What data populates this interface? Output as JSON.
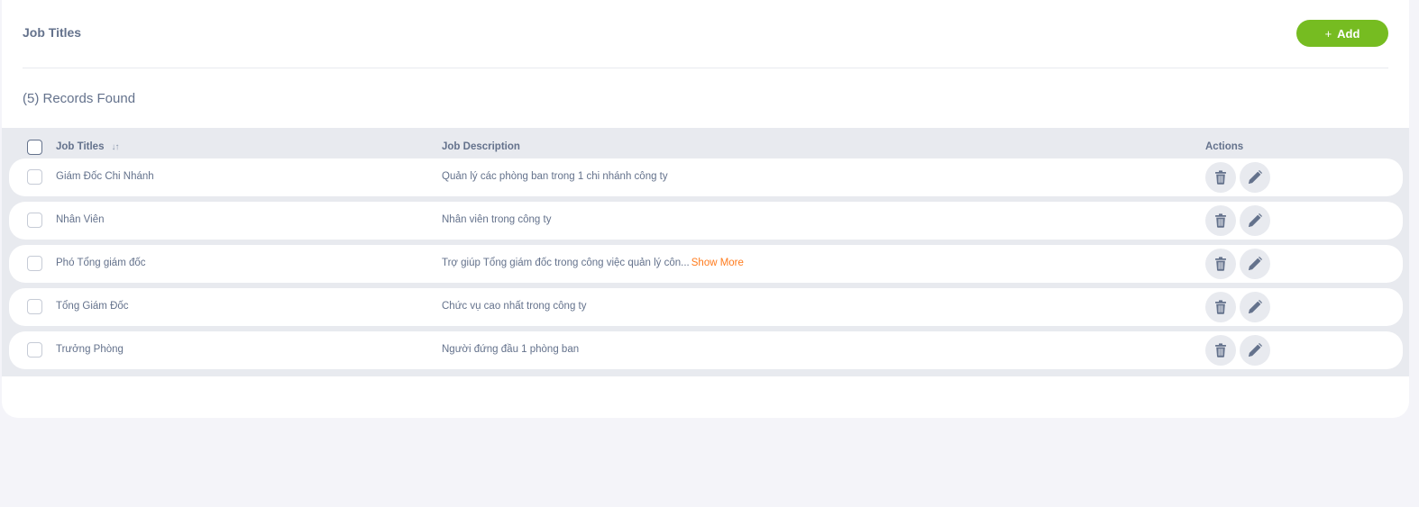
{
  "header": {
    "title": "Job Titles",
    "add_label": "Add",
    "add_icon": "plus-icon",
    "accent_color": "#76bc21"
  },
  "records_found": "(5) Records Found",
  "table": {
    "columns": {
      "title": "Job Titles",
      "description": "Job Description",
      "actions": "Actions"
    },
    "rows": [
      {
        "title": "Giám Đốc Chi Nhánh",
        "description": "Quản lý các phòng ban trong 1 chi nhánh công ty",
        "more": ""
      },
      {
        "title": "Nhân Viên",
        "description": "Nhân viên trong công ty",
        "more": ""
      },
      {
        "title": "Phó Tổng giám đốc",
        "description": "Trợ giúp Tổng giám đốc trong công việc quản lý côn...",
        "more": "Show More"
      },
      {
        "title": "Tổng Giám Đốc",
        "description": "Chức vụ cao nhất trong công ty",
        "more": ""
      },
      {
        "title": "Trưởng Phòng",
        "description": "Người đứng đầu 1 phòng ban",
        "more": ""
      }
    ],
    "action_icons": [
      "trash-icon",
      "pencil-icon"
    ]
  }
}
